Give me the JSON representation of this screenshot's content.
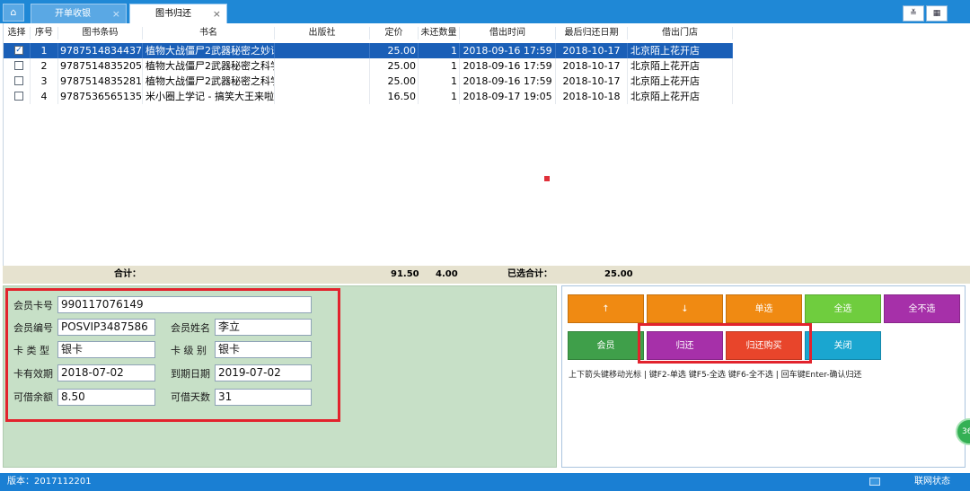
{
  "tabs": {
    "home_icon": "⌂",
    "items": [
      {
        "label": "开单收银",
        "close": "×"
      },
      {
        "label": "图书归还",
        "close": "×"
      }
    ],
    "right_buttons": [
      "≚",
      "▦"
    ]
  },
  "grid": {
    "headers": [
      "选择",
      "序号",
      "图书条码",
      "书名",
      "出版社",
      "定价",
      "未还数量",
      "借出时间",
      "最后归还日期",
      "借出门店"
    ],
    "rows": [
      {
        "checked": "✓",
        "no": "1",
        "barcode": "9787514834437",
        "title": "植物大战僵尸2武器秘密之妙语说",
        "publisher": "",
        "price": "25.00",
        "qty": "1",
        "lend_time": "2018-09-16 17:59",
        "due": "2018-10-17",
        "store": "北京陌上花开店"
      },
      {
        "checked": "",
        "no": "2",
        "barcode": "9787514835205",
        "title": "植物大战僵尸2武器秘密之科学漫",
        "publisher": "",
        "price": "25.00",
        "qty": "1",
        "lend_time": "2018-09-16 17:59",
        "due": "2018-10-17",
        "store": "北京陌上花开店"
      },
      {
        "checked": "",
        "no": "3",
        "barcode": "9787514835281",
        "title": "植物大战僵尸2武器秘密之科学漫",
        "publisher": "",
        "price": "25.00",
        "qty": "1",
        "lend_time": "2018-09-16 17:59",
        "due": "2018-10-17",
        "store": "北京陌上花开店"
      },
      {
        "checked": "",
        "no": "4",
        "barcode": "9787536565135",
        "title": "米小圈上学记 - 搞笑大王来啦",
        "publisher": "",
        "price": "16.50",
        "qty": "1",
        "lend_time": "2018-09-17 19:05",
        "due": "2018-10-18",
        "store": "北京陌上花开店"
      }
    ]
  },
  "totals": {
    "label": "合计：",
    "price_sum": "91.50",
    "qty_sum": "4.00",
    "selected_label": "已选合计：",
    "selected_sum": "25.00"
  },
  "member": {
    "card_no_label": "会员卡号",
    "card_no": "990117076149",
    "member_id_label": "会员编号",
    "member_id": "POSVIP3487586",
    "name_label": "会员姓名",
    "name": "李立",
    "card_type_label": "卡 类 型",
    "card_type": "银卡",
    "card_level_label": "卡 级 别",
    "card_level": "银卡",
    "valid_label": "卡有效期",
    "valid": "2018-07-02",
    "expire_label": "到期日期",
    "expire": "2019-07-02",
    "balance_label": "可借余额",
    "balance": "8.50",
    "days_label": "可借天数",
    "days": "31"
  },
  "actions": {
    "up": "↑",
    "down": "↓",
    "single": "单选",
    "all": "全选",
    "none": "全不选",
    "member": "会员",
    "return": "归还",
    "return_buy": "归还购买",
    "close": "关闭",
    "hint": "上下箭头键移动光标 | 键F2-单选 键F5-全选 键F6-全不选 | 回车键Enter-确认归还"
  },
  "float_badge": "36",
  "status": {
    "version": "版本：2017112201",
    "network": "联网状态"
  },
  "colors": {
    "tab_bar": "#1f88d6",
    "selected_row": "#1a5fb7",
    "totals_bg": "#e6e2cf",
    "member_bg": "#c7e0c7",
    "highlight_frame": "#e2232d",
    "status_bar": "#1a7fd3"
  }
}
